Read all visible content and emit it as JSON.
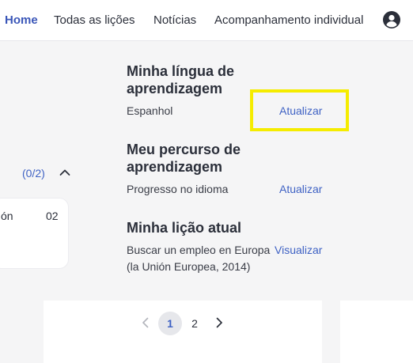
{
  "nav": {
    "items": [
      {
        "label": "Home",
        "active": true
      },
      {
        "label": "Todas as lições"
      },
      {
        "label": "Notícias"
      },
      {
        "label": "Acompanhamento individual"
      }
    ],
    "account_icon": "user-circle-icon"
  },
  "sections": {
    "language": {
      "title": "Minha língua de aprendizagem",
      "value": "Espanhol",
      "action": "Atualizar"
    },
    "path": {
      "title": "Meu percurso de aprendizagem",
      "value": "Progresso no idioma",
      "action": "Atualizar"
    },
    "lesson": {
      "title": "Minha lição atual",
      "value": "Buscar un empleo en Europa (la Unión Europea, 2014)",
      "action": "Visualizar"
    }
  },
  "left_panel": {
    "progress": "(0/2)",
    "card_left_text": "ón",
    "card_right_text": "02"
  },
  "pagination": {
    "pages": [
      "1",
      "2"
    ],
    "current": "1"
  },
  "colors": {
    "accent": "#3f62c4",
    "highlight": "#f5ec00",
    "background": "#f5f5f6"
  }
}
